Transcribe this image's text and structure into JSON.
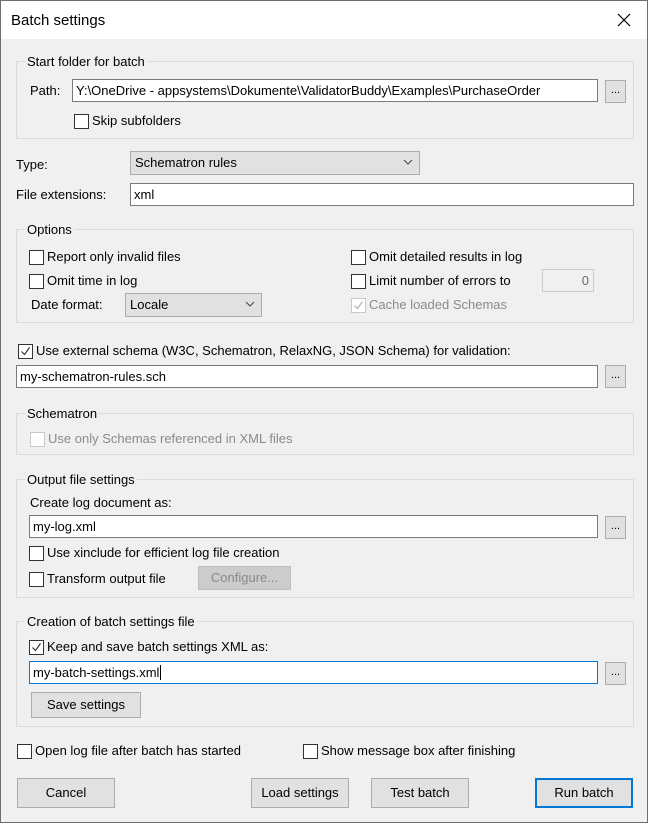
{
  "window": {
    "title": "Batch settings",
    "close_icon": "close-icon"
  },
  "start_folder": {
    "legend": "Start folder for batch",
    "path_label": "Path:",
    "path_value": "Y:\\OneDrive - appsystems\\Dokumente\\ValidatorBuddy\\Examples\\PurchaseOrder",
    "browse_label": "...",
    "skip_subfolders": {
      "label": "Skip subfolders",
      "checked": false
    }
  },
  "type": {
    "label": "Type:",
    "value": "Schematron rules"
  },
  "file_extensions": {
    "label": "File extensions:",
    "value": "xml"
  },
  "options": {
    "legend": "Options",
    "report_only_invalid": {
      "label": "Report only invalid files",
      "checked": false
    },
    "omit_time": {
      "label": "Omit time in log",
      "checked": false
    },
    "date_format_label": "Date format:",
    "date_format_value": "Locale",
    "omit_detailed": {
      "label": "Omit detailed results in log",
      "checked": false
    },
    "limit_errors": {
      "label": "Limit number of errors to",
      "checked": false,
      "value": "0"
    },
    "cache_schemas": {
      "label": "Cache loaded Schemas",
      "checked": true,
      "disabled": true
    }
  },
  "external_schema": {
    "label": "Use external schema (W3C, Schematron, RelaxNG, JSON Schema) for validation:",
    "checked": true,
    "value": "my-schematron-rules.sch",
    "browse_label": "..."
  },
  "schematron": {
    "legend": "Schematron",
    "use_only_referenced": {
      "label": "Use only Schemas referenced in XML files",
      "checked": false,
      "disabled": true
    }
  },
  "output": {
    "legend": "Output file settings",
    "create_log_label": "Create log document as:",
    "log_value": "my-log.xml",
    "browse_label": "...",
    "use_xinclude": {
      "label": "Use xinclude for efficient log file creation",
      "checked": false
    },
    "transform_output": {
      "label": "Transform output file",
      "checked": false
    },
    "configure_label": "Configure..."
  },
  "batch_file": {
    "legend": "Creation of batch settings file",
    "keep_and_save": {
      "label": "Keep and save batch settings XML as:",
      "checked": true
    },
    "value": "my-batch-settings.xml",
    "browse_label": "...",
    "save_settings_label": "Save settings"
  },
  "open_log_after": {
    "label": "Open log file after batch has started",
    "checked": false
  },
  "show_message_box": {
    "label": "Show message box after finishing",
    "checked": false
  },
  "buttons": {
    "cancel": "Cancel",
    "load_settings": "Load settings",
    "test_batch": "Test batch",
    "run_batch": "Run batch"
  }
}
